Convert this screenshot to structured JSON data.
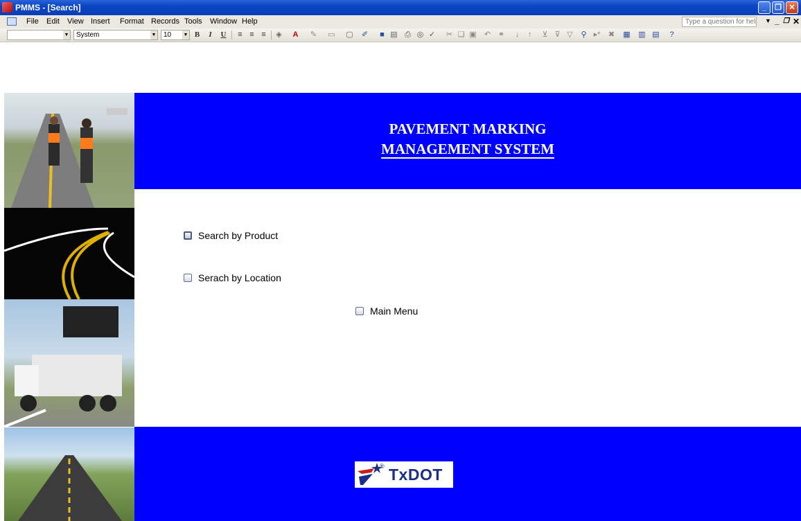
{
  "window": {
    "title": "PMMS - [Search]",
    "controls": {
      "minimize": "_",
      "restore": "❐",
      "close": "✕"
    }
  },
  "menubar": {
    "items": [
      "File",
      "Edit",
      "View",
      "Insert",
      "Format",
      "Records",
      "Tools",
      "Window",
      "Help"
    ],
    "help_placeholder": "Type a question for help"
  },
  "toolbar": {
    "object_combo": "",
    "font_combo": "System",
    "size_combo": "10",
    "bold": "B",
    "italic": "I",
    "underline": "U"
  },
  "header": {
    "title_line1": "PAVEMENT MARKING",
    "title_line2": "MANAGEMENT SYSTEM"
  },
  "options": {
    "search_product": "Search by Product",
    "search_location": "Serach by Location",
    "main_menu": "Main Menu"
  },
  "footer": {
    "logo_text": "TxDOT",
    "logo_mark": "®"
  },
  "colors": {
    "band_blue": "#0000ff",
    "titlebar_blue": "#0a45c4"
  }
}
